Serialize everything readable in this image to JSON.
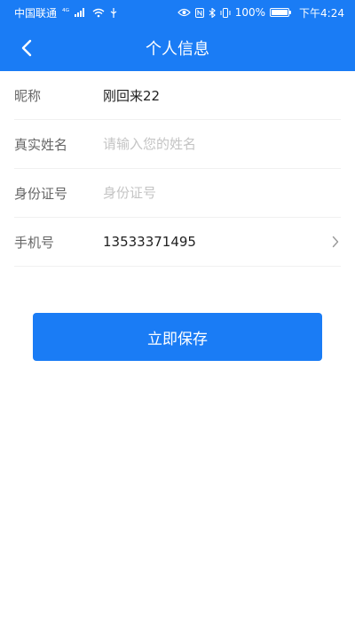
{
  "status_bar": {
    "carrier": "中国联通",
    "network": "⁴ᴳ",
    "battery_pct": "100%",
    "time": "下午4:24"
  },
  "nav": {
    "title": "个人信息"
  },
  "form": {
    "nickname": {
      "label": "昵称",
      "value": "刚回来22"
    },
    "real_name": {
      "label": "真实姓名",
      "placeholder": "请输入您的姓名"
    },
    "id_number": {
      "label": "身份证号",
      "placeholder": "身份证号"
    },
    "phone": {
      "label": "手机号",
      "value": "13533371495"
    }
  },
  "actions": {
    "save_label": "立即保存"
  },
  "colors": {
    "primary": "#1a7cf5"
  }
}
